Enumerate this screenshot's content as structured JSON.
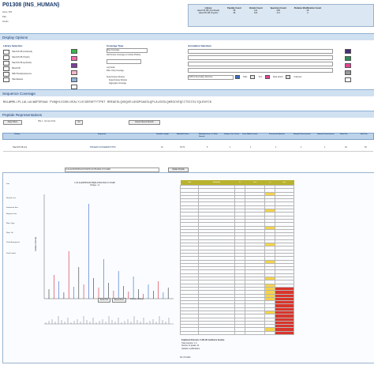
{
  "header": {
    "title": "P01308 (INS_HUMAN)",
    "meta_lines": [
      "Gene: INS",
      "PE1",
      "Insulin"
    ]
  },
  "library_table": {
    "columns": [
      "Library",
      "Peptide Count",
      "Variant Count",
      "Spectrum Count",
      "Putative Modification Count"
    ],
    "rows": [
      [
        "HasoVIS KB (combined)",
        "58",
        "141",
        "205",
        "29"
      ],
      [
        "HasoVIS KB (Tryptic)",
        "46",
        "101",
        "171",
        "2"
      ]
    ]
  },
  "sections": {
    "display_options": "Display Options",
    "sequence_coverage": "Sequence Coverage",
    "peptide_representatives": "Peptide Representatives"
  },
  "display_options": {
    "library_selection_label": "Library Selection",
    "libraries": [
      {
        "name": "HasoVIS KB (combined)",
        "color": "#39b54a"
      },
      {
        "name": "HasoVIS KB (Tryptic)",
        "color": "#f06aa8"
      },
      {
        "name": "HasoVIS KB (synthetic)",
        "color": "#7b3f9e"
      },
      {
        "name": "Mitosil KB",
        "color": "#f5b7c8"
      },
      {
        "name": "NRF Phosphoproteome",
        "color": "#8fb3d9"
      },
      {
        "name": "HasoVariants",
        "color": "#ffffff"
      }
    ],
    "coverage_type_label": "Coverage Type",
    "coverage_value": "Pep Coverage",
    "coverage_checks": [
      "Add Known Coverage to Include Positive",
      "Log Scale",
      "Filter Only Coverage"
    ],
    "superimpose_label": "Superimpose libraries",
    "superimpose_opts": [
      "Superimpose libraries",
      "Aggregate Coverage"
    ],
    "annotation_label": "Annotation Selection",
    "annotation_value": "UniProt Secondary Structure",
    "annotation_legend": [
      "Helix",
      "Turn",
      "Beta strand",
      "Unknown"
    ],
    "annotation_colors": [
      "#4b2a78",
      "#2e8b57",
      "#e84393",
      "#999999",
      "#ffffff"
    ]
  },
  "sequence": {
    "text": "MALWMRLLPLLALLALWGPDPAAA FVNQHLCGSHLVEALYLVCGERGFFYTPKT RREAEDLQVGQVELGGGPGAGSLQPLALEGSLQKRGIVEQCCTSICSLYQLENYCN"
  },
  "peptides": {
    "show_filters_button": "Apply Filters",
    "columns": [
      "Library",
      "Sequence",
      "Peptide Length",
      "Matched Score",
      "Matched ions in Y Best Search",
      "Unique Con Count",
      "Cons Match Count",
      "Processed Spectra",
      "Sample Occurrences",
      "Dataset Occurrences",
      "Start Pos",
      "End Pos"
    ],
    "export_button": "Export Filtered Results",
    "go_button": "Go",
    "hits_label": "Hits 1 - 10 out of 141",
    "row": [
      "HasoVIS KB (co)",
      "SHLVEALYLVCGERGFFYTPK",
      "21",
      "33.73",
      "5",
      "1",
      "1",
      "1",
      "1",
      "1",
      "34",
      "54"
    ]
  },
  "spectrum": {
    "peptide_label": "LLSLALWGPDPAAAFVNQHLCGSHLVEALYLVCGER",
    "subtitle": "Annotated Spectrum Identifier (SID)",
    "charge_label": "Charge: +3",
    "update_button": "Update Peptide",
    "zoom_button": "Zoom Out",
    "reset_button": "Reset Zoom",
    "display_label": "Display settings",
    "y_label": "Relative Intensity"
  },
  "left_tools": {
    "items": [
      "Ions",
      "Neutral Loss",
      "Immonium Ions",
      "Reporter Ions",
      "Mass Type",
      "Mass Tol",
      "Peak Assignment",
      "Peak Labels"
    ]
  },
  "peak_table": {
    "columns": [
      "m/z",
      "Intensity",
      "b",
      "b++",
      "y",
      "y++"
    ],
    "rows_count": 44,
    "highlight_color": "#f5d44a",
    "red_color": "#d9342b",
    "footer_lines": [
      "Explained Intensity: 0.423 (21 backbone breaks)",
      "Total Intensity: 1.0",
      "Number of peaks: 44",
      "Variable modifications:"
    ]
  },
  "footer_label": "SC: P3 2001"
}
